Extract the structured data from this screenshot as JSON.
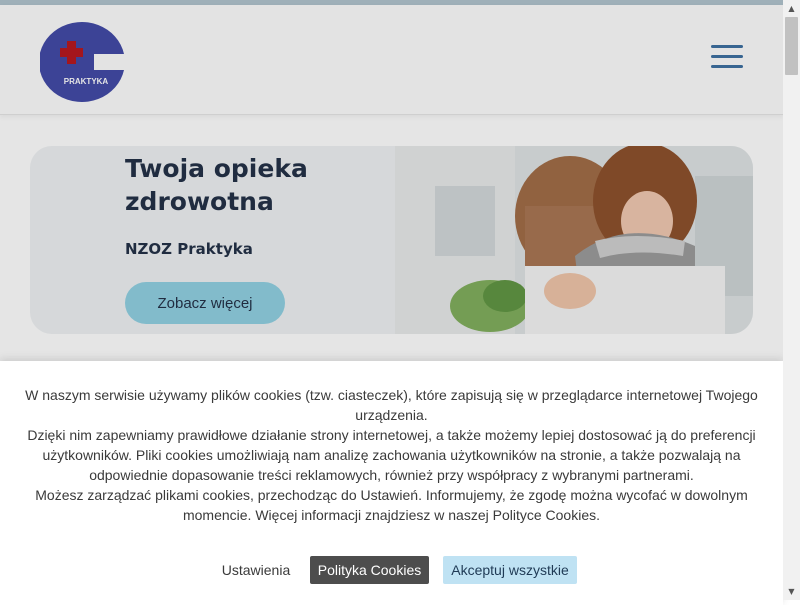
{
  "header": {
    "logo_text": "PRAKTYKA",
    "menu_icon": "hamburger-menu-icon"
  },
  "hero": {
    "title": "Twoja opieka zdrowotna",
    "subtitle": "NZOZ Praktyka",
    "button_label": "Zobacz więcej"
  },
  "cookie": {
    "paragraphs": [
      "W naszym serwisie używamy plików cookies (tzw. ciasteczek), które zapisują się w przeglądarce internetowej Twojego urządzenia.",
      "Dzięki nim zapewniamy prawidłowe działanie strony internetowej, a także możemy lepiej dostosować ją do preferencji użytkowników. Pliki cookies umożliwiają nam analizę zachowania użytkowników na stronie, a także pozwalają na odpowiednie dopasowanie treści reklamowych, również przy współpracy z wybranymi partnerami.",
      "Możesz zarządzać plikami cookies, przechodząc do Ustawień. Informujemy, że zgodę można wycofać w dowolnym momencie. Więcej informacji znajdziesz w naszej Polityce Cookies."
    ],
    "settings_label": "Ustawienia",
    "policy_label": "Polityka Cookies",
    "accept_label": "Akceptuj wszystkie"
  },
  "colors": {
    "logo_blue": "#3f47a6",
    "logo_red": "#b5141c",
    "accent_button": "#8fd0e2",
    "accept_button": "#bfe2f3",
    "policy_button": "#4d4d4d",
    "heading": "#1f2d44"
  }
}
